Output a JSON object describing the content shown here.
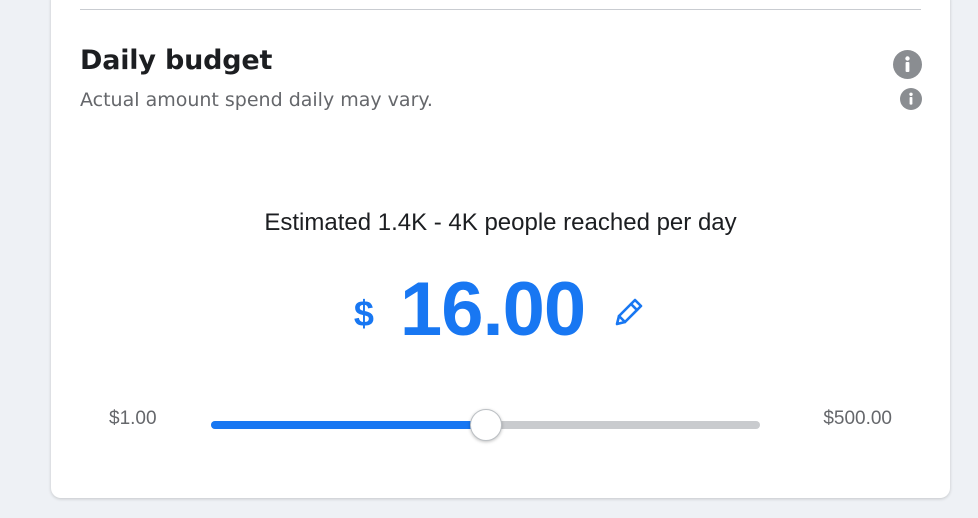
{
  "budget": {
    "title": "Daily budget",
    "subtitle": "Actual amount spend daily may vary.",
    "estimate": "Estimated 1.4K - 4K people reached per day",
    "currency": "$",
    "amount": "16.00",
    "range_min": "$1.00",
    "range_max": "$500.00",
    "slider_position_fraction": 0.5
  },
  "icons": {
    "info_primary": "info-icon",
    "info_secondary": "info-icon",
    "edit": "pencil-icon"
  },
  "colors": {
    "accent": "#1877f2",
    "muted_text": "#65676b",
    "track": "#c9cbce",
    "icon_gray": "#8a8d91"
  }
}
